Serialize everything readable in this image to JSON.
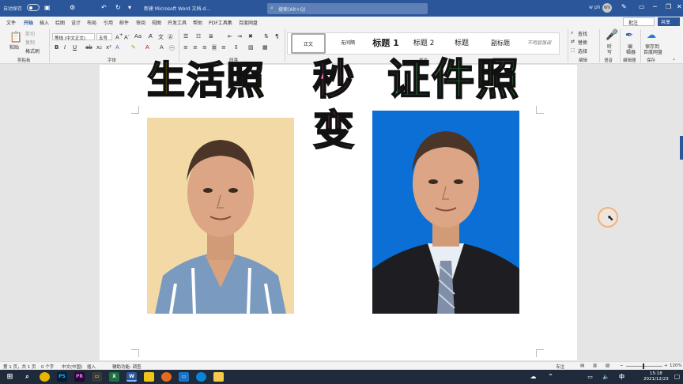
{
  "titlebar": {
    "autosave_label": "自动保存",
    "doc_title": "新建 Microsoft Word 文档.d...",
    "search_placeholder": "搜索(Alt+Q)",
    "user_name": "w ph",
    "avatar_initials": "WX"
  },
  "tabs": [
    "文件",
    "开始",
    "插入",
    "绘图",
    "设计",
    "布局",
    "引用",
    "邮件",
    "审阅",
    "视图",
    "开发工具",
    "帮助",
    "PDF工具集",
    "百度网盘"
  ],
  "active_tab": "开始",
  "comment_label": "批注",
  "share_label": "共享",
  "clipboard": {
    "paste": "粘贴",
    "cut": "剪切",
    "copy": "复制",
    "format_painter": "格式刷",
    "group_label": "剪贴板"
  },
  "font": {
    "name": "等线 (中文正文)",
    "size": "五号",
    "group_label": "字体"
  },
  "paragraph": {
    "group_label": "段落"
  },
  "styles": {
    "items": [
      "正文",
      "无间隔",
      "标题 1",
      "标题 2",
      "标题",
      "副标题",
      "不明显强调"
    ],
    "selected": "正文",
    "group_label": "样式"
  },
  "editing": {
    "find": "查找",
    "replace": "替换",
    "select": "选择",
    "group_label": "编辑"
  },
  "voice": {
    "dictate_line1": "听",
    "dictate_line2": "写",
    "group_label": "语音"
  },
  "editor": {
    "label_line1": "编",
    "label_line2": "辑器",
    "group_label": "编辑器"
  },
  "save": {
    "label_line1": "保存到",
    "label_line2": "百度网盘",
    "group_label": "保存"
  },
  "document": {
    "headline_left": "生活照",
    "headline_mid_1": "秒",
    "headline_mid_2": "变",
    "headline_right": "证件照",
    "colors": {
      "left": "#fbe100",
      "mid": "#ff77c7",
      "right": "#56e06a",
      "id_photo_bg": "#0b6fd6",
      "casual_bg": "#f2d9a6"
    }
  },
  "status": {
    "page": "第 1 页，共 1 页",
    "words": "0 个字",
    "language": "中文(中国)",
    "insert": "插入",
    "accessibility": "辅助功能: 调查",
    "focus": "专注",
    "zoom": "120%"
  },
  "taskbar": {
    "time": "15:18",
    "date": "2021/12/23",
    "apps": [
      "PS",
      "PR",
      "W",
      "X"
    ]
  }
}
